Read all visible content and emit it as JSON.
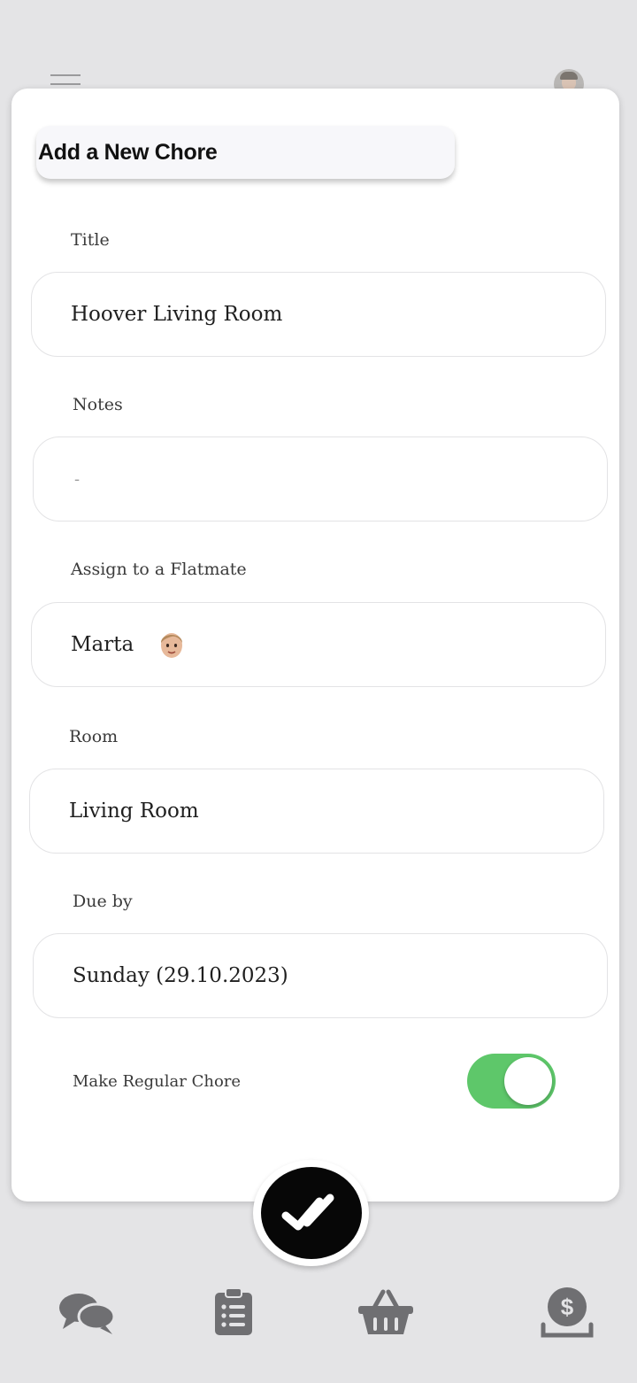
{
  "header": {
    "menu_icon": "hamburger-menu-icon",
    "avatar_icon": "user-avatar-icon"
  },
  "form": {
    "heading": "Add a New Chore",
    "title_label": "Title",
    "title_value": "Hoover Living Room",
    "notes_label": "Notes",
    "notes_placeholder": "-",
    "assign_label": "Assign to a Flatmate",
    "assign_value": "Marta",
    "room_label": "Room",
    "room_value": "Living Room",
    "due_label": "Due by",
    "due_value": "Sunday (29.10.2023)",
    "regular_label": "Make Regular Chore",
    "regular_enabled": true
  },
  "colors": {
    "toggle_on": "#5ec76a",
    "fab": "#070707",
    "nav_icon": "#6f6f72"
  },
  "nav": {
    "items": [
      "chat-icon",
      "clipboard-list-icon",
      "shopping-basket-icon",
      "money-icon"
    ]
  }
}
